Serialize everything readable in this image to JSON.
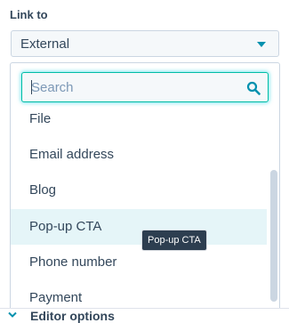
{
  "field": {
    "label": "Link to",
    "selected": "External"
  },
  "search": {
    "placeholder": "Search",
    "value": ""
  },
  "options": [
    {
      "label": "File"
    },
    {
      "label": "Email address"
    },
    {
      "label": "Blog"
    },
    {
      "label": "Pop-up CTA"
    },
    {
      "label": "Phone number"
    },
    {
      "label": "Payment"
    }
  ],
  "tooltip": "Pop-up CTA",
  "section": {
    "title": "Editor options"
  },
  "colors": {
    "accent": "#0091ae",
    "focus_border": "#00bda5",
    "hover_bg": "#e5f5f8",
    "text": "#33475b"
  }
}
